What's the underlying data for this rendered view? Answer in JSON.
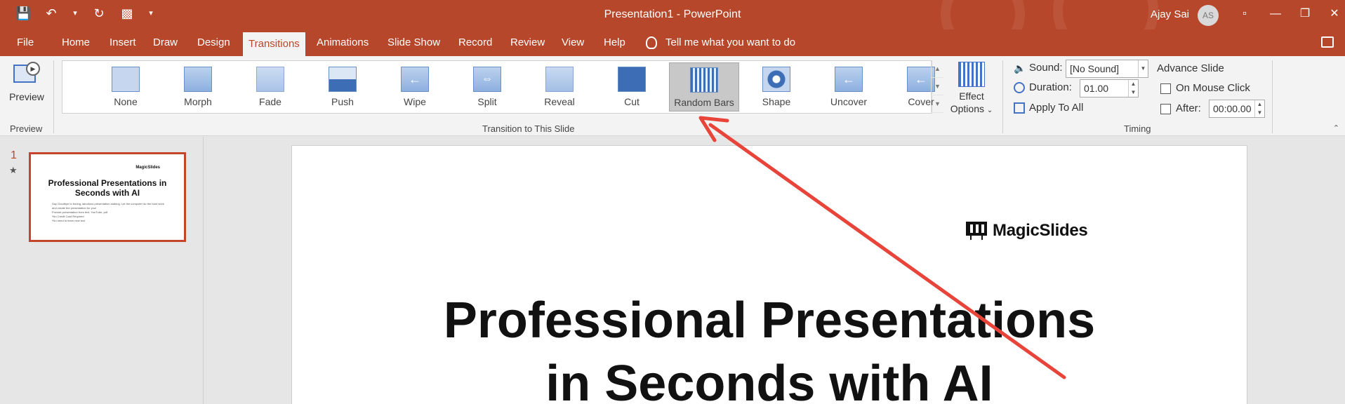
{
  "titlebar": {
    "document_title": "Presentation1  -  PowerPoint",
    "user_name": "Ajay Sai",
    "avatar_initials": "AS",
    "qat": [
      "save-icon",
      "undo-icon",
      "redo-icon",
      "present-from-start-icon",
      "customize-qat-icon"
    ]
  },
  "menu": {
    "file": "File",
    "tabs": [
      "Home",
      "Insert",
      "Draw",
      "Design",
      "Transitions",
      "Animations",
      "Slide Show",
      "Record",
      "Review",
      "View",
      "Help"
    ],
    "active_tab": "Transitions",
    "tell_me": "Tell me what you want to do"
  },
  "ribbon": {
    "preview": {
      "label": "Preview",
      "group": "Preview"
    },
    "transitions": {
      "group": "Transition to This Slide",
      "items": [
        "None",
        "Morph",
        "Fade",
        "Push",
        "Wipe",
        "Split",
        "Reveal",
        "Cut",
        "Random Bars",
        "Shape",
        "Uncover",
        "Cover"
      ],
      "selected": "Random Bars"
    },
    "effect_options": {
      "line1": "Effect",
      "line2": "Options"
    },
    "timing": {
      "group": "Timing",
      "sound_label": "Sound:",
      "sound_value": "[No Sound]",
      "duration_label": "Duration:",
      "duration_value": "01.00",
      "apply_all": "Apply To All",
      "advance_title": "Advance Slide",
      "on_mouse_click": "On Mouse Click",
      "after_label": "After:",
      "after_value": "00:00.00"
    }
  },
  "thumbnails": {
    "slide_number": "1",
    "star": "★",
    "logo": "MagicSlides",
    "title": "Professional Presentations in Seconds with AI",
    "body": [
      "Say Goodbye to boring, laborious presentation-making. Let the computer do the hard work and create the presentation for you!",
      "Provide presentation from text, YouTube, pdf",
      "*No Credit Card Required",
      "*No need to learn new tool"
    ]
  },
  "slide": {
    "logo": "MagicSlides",
    "title_line1": "Professional Presentations",
    "title_line2": "in Seconds with AI"
  },
  "colors": {
    "brand": "#b7472a",
    "annotation_arrow": "#e8443a"
  }
}
